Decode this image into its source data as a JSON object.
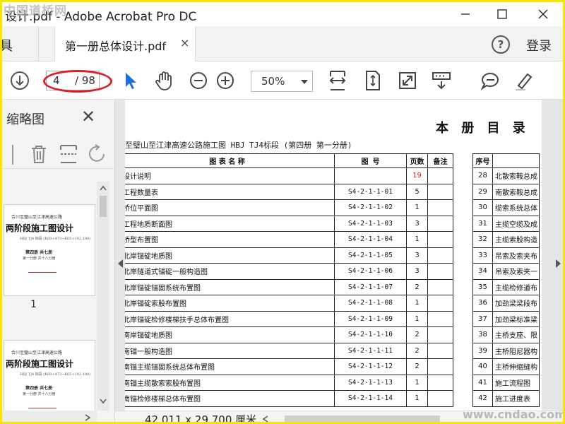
{
  "window": {
    "title": "设计.pdf - Adobe Acrobat Pro DC",
    "watermark_top": "中国道桥网",
    "minimize_icon": "minimize-icon",
    "maximize_icon": "maximize-icon",
    "close_icon": "close-icon"
  },
  "tabs": {
    "tools_label": "具",
    "document_tab_label": "第一册总体设计.pdf",
    "close_tab_glyph": "×",
    "help_glyph": "?",
    "login_label": "登录"
  },
  "toolbar": {
    "current_page": "4",
    "total_pages": "/ 98",
    "zoom": "50%",
    "highlight_color": "#d9202a"
  },
  "left_panel": {
    "title": "缩略图",
    "close_glyph": "✕",
    "thumbnail_1": {
      "line1": "合川至璧山至江津高速公路",
      "big": "两阶段施工图设计",
      "line2": "HBJ TJ4 标段 (K60+473~K65+102.100)",
      "line3": "第四册 共七册",
      "line4": "第一分册 共十八分册",
      "page_label": "1"
    },
    "thumbnail_2": {
      "line1": "合川至璧山至江津高速公路",
      "big": "两阶段施工图设计",
      "line2": "HBJ TJ4 标段 (K60+473~K65+102.100)",
      "line3": "第四册 共七册",
      "line4": "第一分册 共十八分册"
    }
  },
  "document": {
    "heading": "本 册 目 录",
    "subtitle": "至璧山至江津高速公路施工图  HBJ TJ4标段  (第四册 第一分册)",
    "table1_headers": [
      "图 表 名 称",
      "图  号",
      "页数",
      "备注"
    ],
    "table1_rows": [
      {
        "name": "设计说明",
        "code": "",
        "pages": "19",
        "remark": ""
      },
      {
        "name": "工程数量表",
        "code": "S4-2-1-1-01",
        "pages": "5",
        "remark": ""
      },
      {
        "name": "桥位平面图",
        "code": "S4-2-1-1-02",
        "pages": "1",
        "remark": ""
      },
      {
        "name": "工程地质断面图",
        "code": "S4-2-1-1-03",
        "pages": "3",
        "remark": ""
      },
      {
        "name": "桥型布置图",
        "code": "S4-2-1-1-04",
        "pages": "1",
        "remark": ""
      },
      {
        "name": "北岸锚碇地质图",
        "code": "S4-2-1-1-05",
        "pages": "3",
        "remark": ""
      },
      {
        "name": "北岸隧道式锚碇一般构造图",
        "code": "S4-2-1-1-06",
        "pages": "3",
        "remark": ""
      },
      {
        "name": "北岸锚碇锚固系统布置图",
        "code": "S4-2-1-1-07",
        "pages": "2",
        "remark": ""
      },
      {
        "name": "北岸锚碇索股布置图",
        "code": "S4-2-1-1-08",
        "pages": "1",
        "remark": ""
      },
      {
        "name": "北岸锚碇检修楼梯扶手总体布置图",
        "code": "S4-2-1-1-09",
        "pages": "1",
        "remark": ""
      },
      {
        "name": "南岸锚碇地质图",
        "code": "S4-2-1-1-10",
        "pages": "2",
        "remark": ""
      },
      {
        "name": "南锚一般构造图",
        "code": "S4-2-1-1-11",
        "pages": "2",
        "remark": ""
      },
      {
        "name": "南锚主缆锚固系统总体布置图",
        "code": "S4-2-1-1-12",
        "pages": "2",
        "remark": ""
      },
      {
        "name": "南锚主缆散索索股布置图",
        "code": "S4-2-1-1-13",
        "pages": "1",
        "remark": ""
      },
      {
        "name": "南锚检修楼梯总体布置图",
        "code": "S4-2-1-1-14",
        "pages": "1",
        "remark": ""
      }
    ],
    "table2_headers": [
      "序号",
      ""
    ],
    "table2_rows": [
      {
        "no": "28",
        "name": "北散索鞍总成"
      },
      {
        "no": "29",
        "name": "南散索鞍总成"
      },
      {
        "no": "30",
        "name": "缆索系统总体"
      },
      {
        "no": "31",
        "name": "主缆空缆及成"
      },
      {
        "no": "32",
        "name": "主缆索股构造"
      },
      {
        "no": "33",
        "name": "吊索及索夹布"
      },
      {
        "no": "34",
        "name": "吊索及索夹一"
      },
      {
        "no": "35",
        "name": "主缆检修道布"
      },
      {
        "no": "36",
        "name": "加劲梁梁段布"
      },
      {
        "no": "37",
        "name": "加劲梁标准梁"
      },
      {
        "no": "38",
        "name": "主桥支座、限"
      },
      {
        "no": "39",
        "name": "主桥阻尼器构"
      },
      {
        "no": "40",
        "name": "主桥伸缩缝构"
      },
      {
        "no": "41",
        "name": "施工流程图"
      },
      {
        "no": "42",
        "name": "施工进度表"
      }
    ]
  },
  "status_bar": {
    "dimensions": "42.011 x 29.700 厘米",
    "watermark_bottom": "www.cndao.com"
  }
}
